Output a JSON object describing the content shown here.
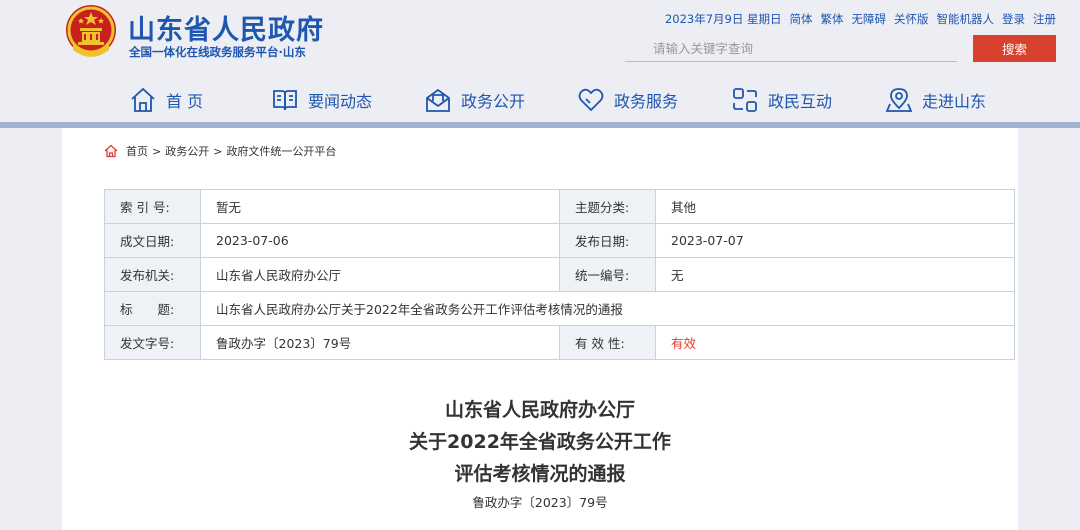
{
  "header": {
    "site_title": "山东省人民政府",
    "site_subtitle": "全国一体化在线政务服务平台·山东",
    "top_links": {
      "date": "2023年7月9日 星期日",
      "simplified": "简体",
      "traditional": "繁体",
      "accessibility": "无障碍",
      "care_mode": "关怀版",
      "robot": "智能机器人",
      "login": "登录",
      "register": "注册"
    },
    "search": {
      "placeholder": "请输入关键字查询",
      "button_label": "搜索"
    }
  },
  "nav": {
    "items": [
      {
        "label": "首 页",
        "icon": "home-icon"
      },
      {
        "label": "要闻动态",
        "icon": "book-icon"
      },
      {
        "label": "政务公开",
        "icon": "mailbox-icon"
      },
      {
        "label": "政务服务",
        "icon": "heart-icon"
      },
      {
        "label": "政民互动",
        "icon": "interaction-icon"
      },
      {
        "label": "走进山东",
        "icon": "location-icon"
      }
    ]
  },
  "breadcrumb": {
    "items": [
      "首页",
      "政务公开",
      "政府文件统一公开平台"
    ],
    "separator": ">"
  },
  "info_table": {
    "rows": [
      {
        "label1": "索 引 号:",
        "value1": "暂无",
        "label2": "主题分类:",
        "value2": "其他"
      },
      {
        "label1": "成文日期:",
        "value1": "2023-07-06",
        "label2": "发布日期:",
        "value2": "2023-07-07"
      },
      {
        "label1": "发布机关:",
        "value1": "山东省人民政府办公厅",
        "label2": "统一编号:",
        "value2": "无"
      },
      {
        "label1": "标　　题:",
        "value1": "山东省人民政府办公厅关于2022年全省政务公开工作评估考核情况的通报"
      },
      {
        "label1": "发文字号:",
        "value1": "鲁政办字〔2023〕79号",
        "label2": "有 效 性:",
        "value2": "有效"
      }
    ]
  },
  "document": {
    "title_line1": "山东省人民政府办公厅",
    "title_line2": "关于2022年全省政务公开工作",
    "title_line3": "评估考核情况的通报",
    "doc_number": "鲁政办字〔2023〕79号"
  },
  "colors": {
    "brand_blue": "#1f56b0",
    "search_red": "#d9412f",
    "validity_red": "#d9412f",
    "label_bg": "#eef2f7"
  }
}
